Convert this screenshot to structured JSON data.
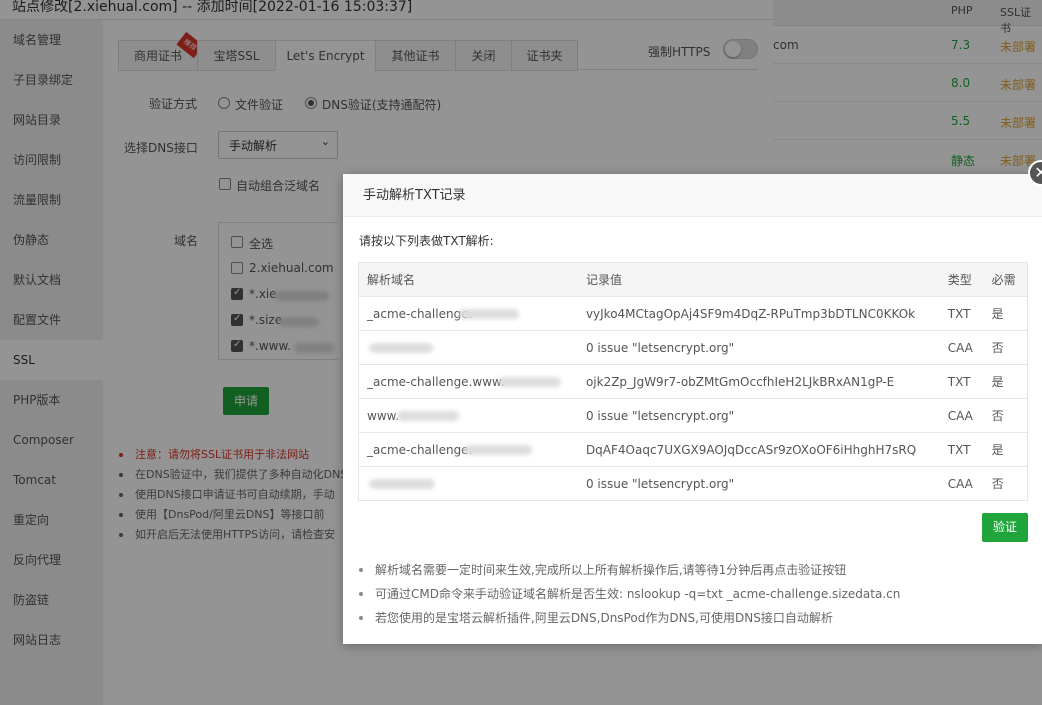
{
  "window_title": "站点修改[2.xiehual.com] -- 添加时间[2022-01-16 15:03:37]",
  "sidebar": {
    "items": [
      {
        "label": "域名管理"
      },
      {
        "label": "子目录绑定"
      },
      {
        "label": "网站目录"
      },
      {
        "label": "访问限制"
      },
      {
        "label": "流量限制"
      },
      {
        "label": "伪静态"
      },
      {
        "label": "默认文档"
      },
      {
        "label": "配置文件"
      },
      {
        "label": "SSL"
      },
      {
        "label": "PHP版本"
      },
      {
        "label": "Composer"
      },
      {
        "label": "Tomcat"
      },
      {
        "label": "重定向"
      },
      {
        "label": "反向代理"
      },
      {
        "label": "防盗链"
      },
      {
        "label": "网站日志"
      }
    ],
    "active": "SSL"
  },
  "tabs": [
    {
      "label": "商用证书",
      "badge": "推荐"
    },
    {
      "label": "宝塔SSL"
    },
    {
      "label": "Let's Encrypt"
    },
    {
      "label": "其他证书"
    },
    {
      "label": "关闭"
    },
    {
      "label": "证书夹"
    }
  ],
  "force_https_label": "强制HTTPS",
  "verify_method": {
    "label": "验证方式",
    "options": [
      "文件验证",
      "DNS验证(支持通配符)"
    ],
    "selected": "DNS验证(支持通配符)"
  },
  "dns_api": {
    "label": "选择DNS接口",
    "value": "手动解析"
  },
  "auto_wildcard_label": "自动组合泛域名",
  "domains": {
    "label": "域名",
    "select_all": "全选",
    "items": [
      {
        "text": "2.xiehual.com",
        "checked": false
      },
      {
        "text": "*.xie",
        "checked": true
      },
      {
        "text": "*.size",
        "checked": true
      },
      {
        "text": "*.www.",
        "checked": true
      }
    ]
  },
  "apply_button": "申请",
  "notes": [
    "注意：请勿将SSL证书用于非法网站",
    "在DNS验证中，我们提供了多种自动化DNS",
    "使用DNS接口申请证书可自动续期，手动",
    "使用【DnsPod/阿里云DNS】等接口前",
    "如开启后无法使用HTTPS访问，请检查安"
  ],
  "bg_list": {
    "headers": {
      "php": "PHP",
      "ssl": "SSL证书"
    },
    "rows": [
      {
        "domain": "com",
        "php": "7.3",
        "ssl": "未部署"
      },
      {
        "domain": "",
        "php": "8.0",
        "ssl": "未部署"
      },
      {
        "domain": "",
        "php": "5.5",
        "ssl": "未部署"
      },
      {
        "domain": "",
        "php": "静态",
        "ssl": "未部署"
      }
    ]
  },
  "modal": {
    "title": "手动解析TXT记录",
    "intro": "请按以下列表做TXT解析:",
    "columns": [
      "解析域名",
      "记录值",
      "类型",
      "必需"
    ],
    "rows": [
      {
        "domain": "_acme-challenge.",
        "value": "vyJko4MCtagOpAj4SF9m4DqZ-RPuTmp3bDTLNC0KKOk",
        "type": "TXT",
        "required": "是"
      },
      {
        "domain": "",
        "value": "0 issue \"letsencrypt.org\"",
        "type": "CAA",
        "required": "否"
      },
      {
        "domain": "_acme-challenge.www.",
        "value": "ojk2Zp_JgW9r7-obZMtGmOccfhIeH2LJkBRxAN1gP-E",
        "type": "TXT",
        "required": "是"
      },
      {
        "domain": "www.",
        "value": "0 issue \"letsencrypt.org\"",
        "type": "CAA",
        "required": "否"
      },
      {
        "domain": "_acme-challenge.",
        "value": "DqAF4Oaqc7UXGX9AOJqDccASr9zOXoOF6iHhghH7sRQ",
        "type": "TXT",
        "required": "是"
      },
      {
        "domain": "",
        "value": "0 issue \"letsencrypt.org\"",
        "type": "CAA",
        "required": "否"
      }
    ],
    "verify_button": "验证",
    "tips": [
      "解析域名需要一定时间来生效,完成所以上所有解析操作后,请等待1分钟后再点击验证按钮",
      "可通过CMD命令来手动验证域名解析是否生效: nslookup -q=txt _acme-challenge.sizedata.cn",
      "若您使用的是宝塔云解析插件,阿里云DNS,DnsPod作为DNS,可使用DNS接口自动解析"
    ]
  }
}
